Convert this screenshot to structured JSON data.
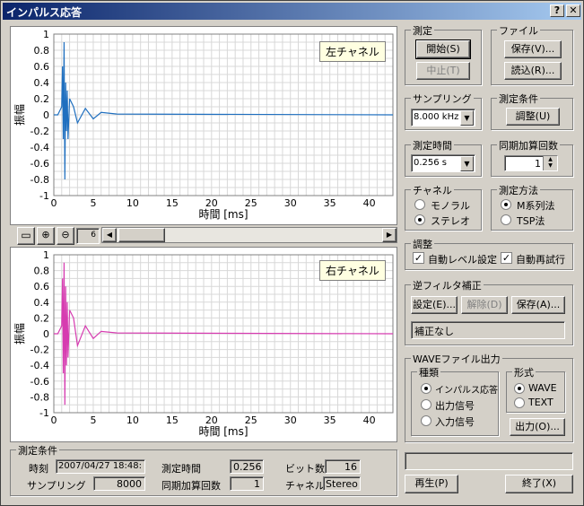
{
  "window": {
    "title": "インパルス応答",
    "help": "?",
    "close": "✕"
  },
  "left_chart": {
    "label": "左チャネル",
    "xlabel": "時間 [ms]",
    "ylabel": "振幅",
    "color": "#1f6fbf"
  },
  "right_chart": {
    "label": "右チャネル",
    "xlabel": "時間 [ms]",
    "ylabel": "振幅",
    "color": "#d63bb0"
  },
  "zoom_value": "6",
  "measure": {
    "title": "測定",
    "start": "開始(S)",
    "stop": "中止(T)"
  },
  "file": {
    "title": "ファイル",
    "save": "保存(V)...",
    "load": "読込(R)..."
  },
  "sampling": {
    "title": "サンプリング",
    "value": "8.000 kHz"
  },
  "conditions": {
    "title": "測定条件",
    "adjust": "調整(U)"
  },
  "mtime": {
    "title": "測定時間",
    "value": "0.256 s"
  },
  "sync": {
    "title": "同期加算回数",
    "value": "1"
  },
  "channel": {
    "title": "チャネル",
    "mono": "モノラル",
    "stereo": "ステレオ"
  },
  "method": {
    "title": "測定方法",
    "m": "M系列法",
    "tsp": "TSP法"
  },
  "adjustment": {
    "title": "調整",
    "auto_level": "自動レベル設定",
    "auto_retry": "自動再試行"
  },
  "filter": {
    "title": "逆フィルタ補正",
    "set": "設定(E)...",
    "release": "解除(D)",
    "save": "保存(A)...",
    "status": "補正なし"
  },
  "wave": {
    "title": "WAVEファイル出力",
    "kind_title": "種類",
    "impulse": "インパルス応答",
    "output": "出力信号",
    "input": "入力信号",
    "format_title": "形式",
    "wave": "WAVE",
    "text": "TEXT",
    "out_btn": "出力(O)..."
  },
  "bottom": {
    "title": "測定条件",
    "time_label": "時刻",
    "time_value": "2007/04/27 18:48:",
    "mtime_label": "測定時間",
    "mtime_value": "0.256",
    "bits_label": "ビット数",
    "bits_value": "16",
    "sr_label": "サンプリング",
    "sr_value": "8000",
    "sync_label": "同期加算回数",
    "sync_value": "1",
    "ch_label": "チャネル",
    "ch_value": "Stereo"
  },
  "play": "再生(P)",
  "exit": "終了(X)",
  "chart_data": {
    "type": "line",
    "x_ticks": [
      "0",
      "5",
      "10",
      "15",
      "20",
      "25",
      "30",
      "35",
      "40"
    ],
    "y_ticks": [
      "1",
      "0.8",
      "0.6",
      "0.4",
      "0.2",
      "0",
      "-0.2",
      "-0.4",
      "-0.6",
      "-0.8",
      "-1"
    ],
    "xlim": [
      0,
      43
    ],
    "ylim": [
      -1,
      1
    ],
    "xlabel": "時間 [ms]",
    "ylabel": "振幅",
    "series": [
      {
        "name": "左チャネル",
        "x": [
          0,
          0.5,
          1,
          1.1,
          1.2,
          1.3,
          1.4,
          1.5,
          1.6,
          1.7,
          1.8,
          2,
          2.5,
          3,
          4,
          5,
          6,
          8,
          43
        ],
        "values": [
          0,
          0,
          0.1,
          0.6,
          -0.3,
          0.9,
          -0.8,
          0.4,
          -0.2,
          0.3,
          -0.3,
          0.2,
          0.1,
          -0.1,
          0.08,
          -0.05,
          0.03,
          0.01,
          0
        ]
      },
      {
        "name": "右チャネル",
        "x": [
          0,
          0.5,
          1,
          1.1,
          1.2,
          1.3,
          1.4,
          1.5,
          1.6,
          1.7,
          1.8,
          2,
          2.5,
          3,
          4,
          5,
          6,
          8,
          43
        ],
        "values": [
          0,
          0,
          0.1,
          0.7,
          -0.5,
          0.9,
          -0.9,
          0.6,
          -0.4,
          0.4,
          -0.3,
          0.3,
          0.2,
          -0.15,
          0.1,
          -0.06,
          0.03,
          0.01,
          0
        ]
      }
    ]
  }
}
